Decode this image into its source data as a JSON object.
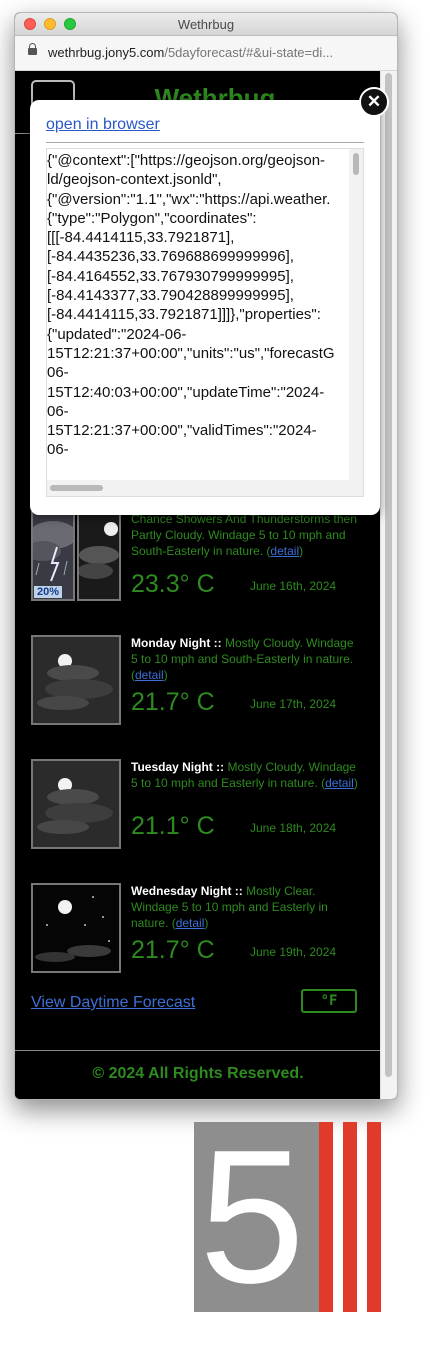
{
  "window": {
    "title": "Wethrbug"
  },
  "url": {
    "host": "wethrbug.jony5.com",
    "path": "/5dayforecast/#&ui-state=di..."
  },
  "site": {
    "title": "Wethrbug"
  },
  "modal": {
    "open_link": "open in browser",
    "close_glyph": "✕",
    "json_lines": [
      "{\"@context\":[\"https://geojson.org/geojson-",
      "ld/geojson-context.jsonld\",",
      "{\"@version\":\"1.1\",\"wx\":\"https://api.weather.",
      "{\"type\":\"Polygon\",\"coordinates\":",
      "[[[-84.4414115,33.7921871],",
      "[-84.4435236,33.769688699999996],",
      "[-84.4164552,33.767930799999995],",
      "[-84.4143377,33.790428899999995],",
      "[-84.4414115,33.7921871]]]},\"properties\":",
      "{\"updated\":\"2024-06-",
      "15T12:21:37+00:00\",\"units\":\"us\",\"forecastG",
      "06-",
      "15T12:40:03+00:00\",\"updateTime\":\"2024-",
      "06-",
      "15T12:21:37+00:00\",\"validTimes\":\"2024-",
      "06-"
    ]
  },
  "forecasts": [
    {
      "period": "",
      "summary": "Chance Showers And Thunderstorms then Partly Cloudy. Windage 5 to 10 mph and South-Easterly in nature.",
      "detail": "detail",
      "temp": "23.3° C",
      "date": "June 16th, 2024",
      "pop": "20%",
      "icon": "thunderstorm-partly-cloudy-night-icon"
    },
    {
      "period": "Monday Night ::",
      "summary": "Mostly Cloudy. Windage 5 to 10 mph and South-Easterly in nature.",
      "detail": "detail",
      "temp": "21.7° C",
      "date": "June 17th, 2024",
      "icon": "mostly-cloudy-night-icon"
    },
    {
      "period": "Tuesday Night ::",
      "summary": "Mostly Cloudy. Windage 5 to 10 mph and Easterly in nature.",
      "detail": "detail",
      "temp": "21.1° C",
      "date": "June 18th, 2024",
      "icon": "mostly-cloudy-night-icon"
    },
    {
      "period": "Wednesday Night ::",
      "summary": "Mostly Clear. Windage 5 to 10 mph and Easterly in nature.",
      "detail": "detail",
      "temp": "21.7° C",
      "date": "June 19th, 2024",
      "icon": "mostly-clear-night-icon"
    }
  ],
  "footer": {
    "daytime_link": "View Daytime Forecast",
    "unit_toggle": "°F",
    "copyright": "© 2024 All Rights Reserved."
  },
  "logo": {
    "digit": "5",
    "label": "jony5-logo"
  },
  "colors": {
    "accent_green": "#2e8b1f",
    "link_blue": "#3d6fd8",
    "logo_red": "#e03a2a",
    "logo_gray": "#8e8e8e"
  }
}
